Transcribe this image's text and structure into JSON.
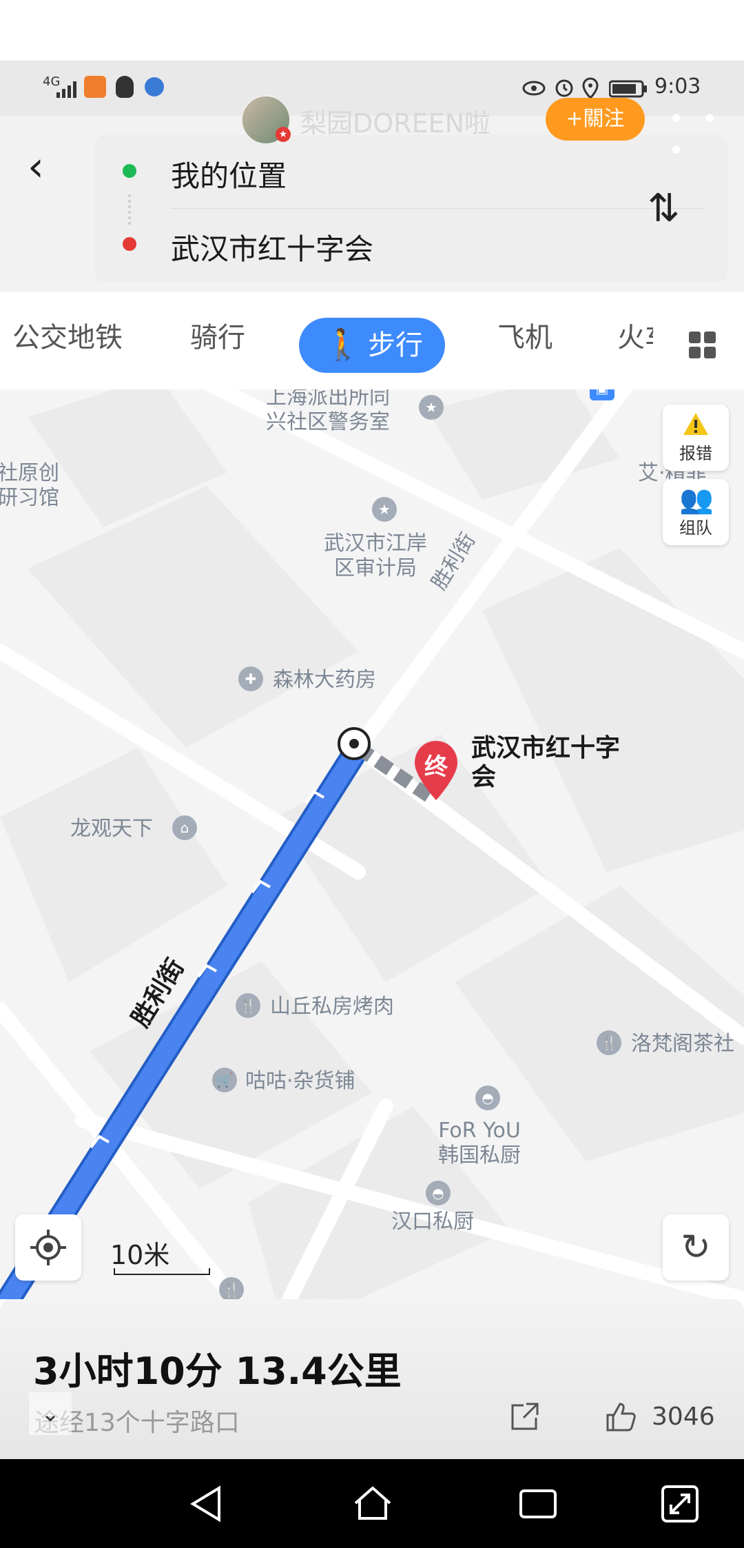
{
  "status_bar": {
    "network": "4G",
    "time": "9:03",
    "icons": [
      "signal-icon",
      "video-app-icon",
      "qq-icon",
      "browser-icon",
      "eye-icon",
      "alarm-icon",
      "location-icon",
      "battery-icon"
    ]
  },
  "profile": {
    "username": "梨园DOREEN啦",
    "follow_label": "+關注",
    "more_label": "• • •"
  },
  "route": {
    "origin": "我的位置",
    "destination": "武汉市红十字会",
    "origin_color": "#1db954",
    "destination_color": "#e53935"
  },
  "modes": {
    "tabs": [
      "公交地铁",
      "骑行",
      "步行",
      "飞机",
      "火车"
    ],
    "active": "步行"
  },
  "map": {
    "pois": [
      {
        "label": "上海派出所同\n兴社区警务室"
      },
      {
        "label": "社原创\n研习馆"
      },
      {
        "label": "武汉市江岸\n区审计局"
      },
      {
        "label": "森林大药房"
      },
      {
        "label": "龙观天下"
      },
      {
        "label": "山丘私房烤肉"
      },
      {
        "label": "洛梵阁茶社"
      },
      {
        "label": "咕咕·杂货铺"
      },
      {
        "label": "FoR YoU\n韩国私厨"
      },
      {
        "label": "汉口私厨"
      },
      {
        "label": "艾·精菲"
      }
    ],
    "street_name": "胜利街",
    "destination_pin": "终",
    "destination_label": "武汉市红十字\n会",
    "report_error_label": "报错",
    "team_label": "组队",
    "scale": "10米",
    "route_color": "#4a84f1"
  },
  "summary": {
    "duration_distance": "3小时10分  13.4公里",
    "via": "途经13个十字路口",
    "likes": "3046"
  }
}
